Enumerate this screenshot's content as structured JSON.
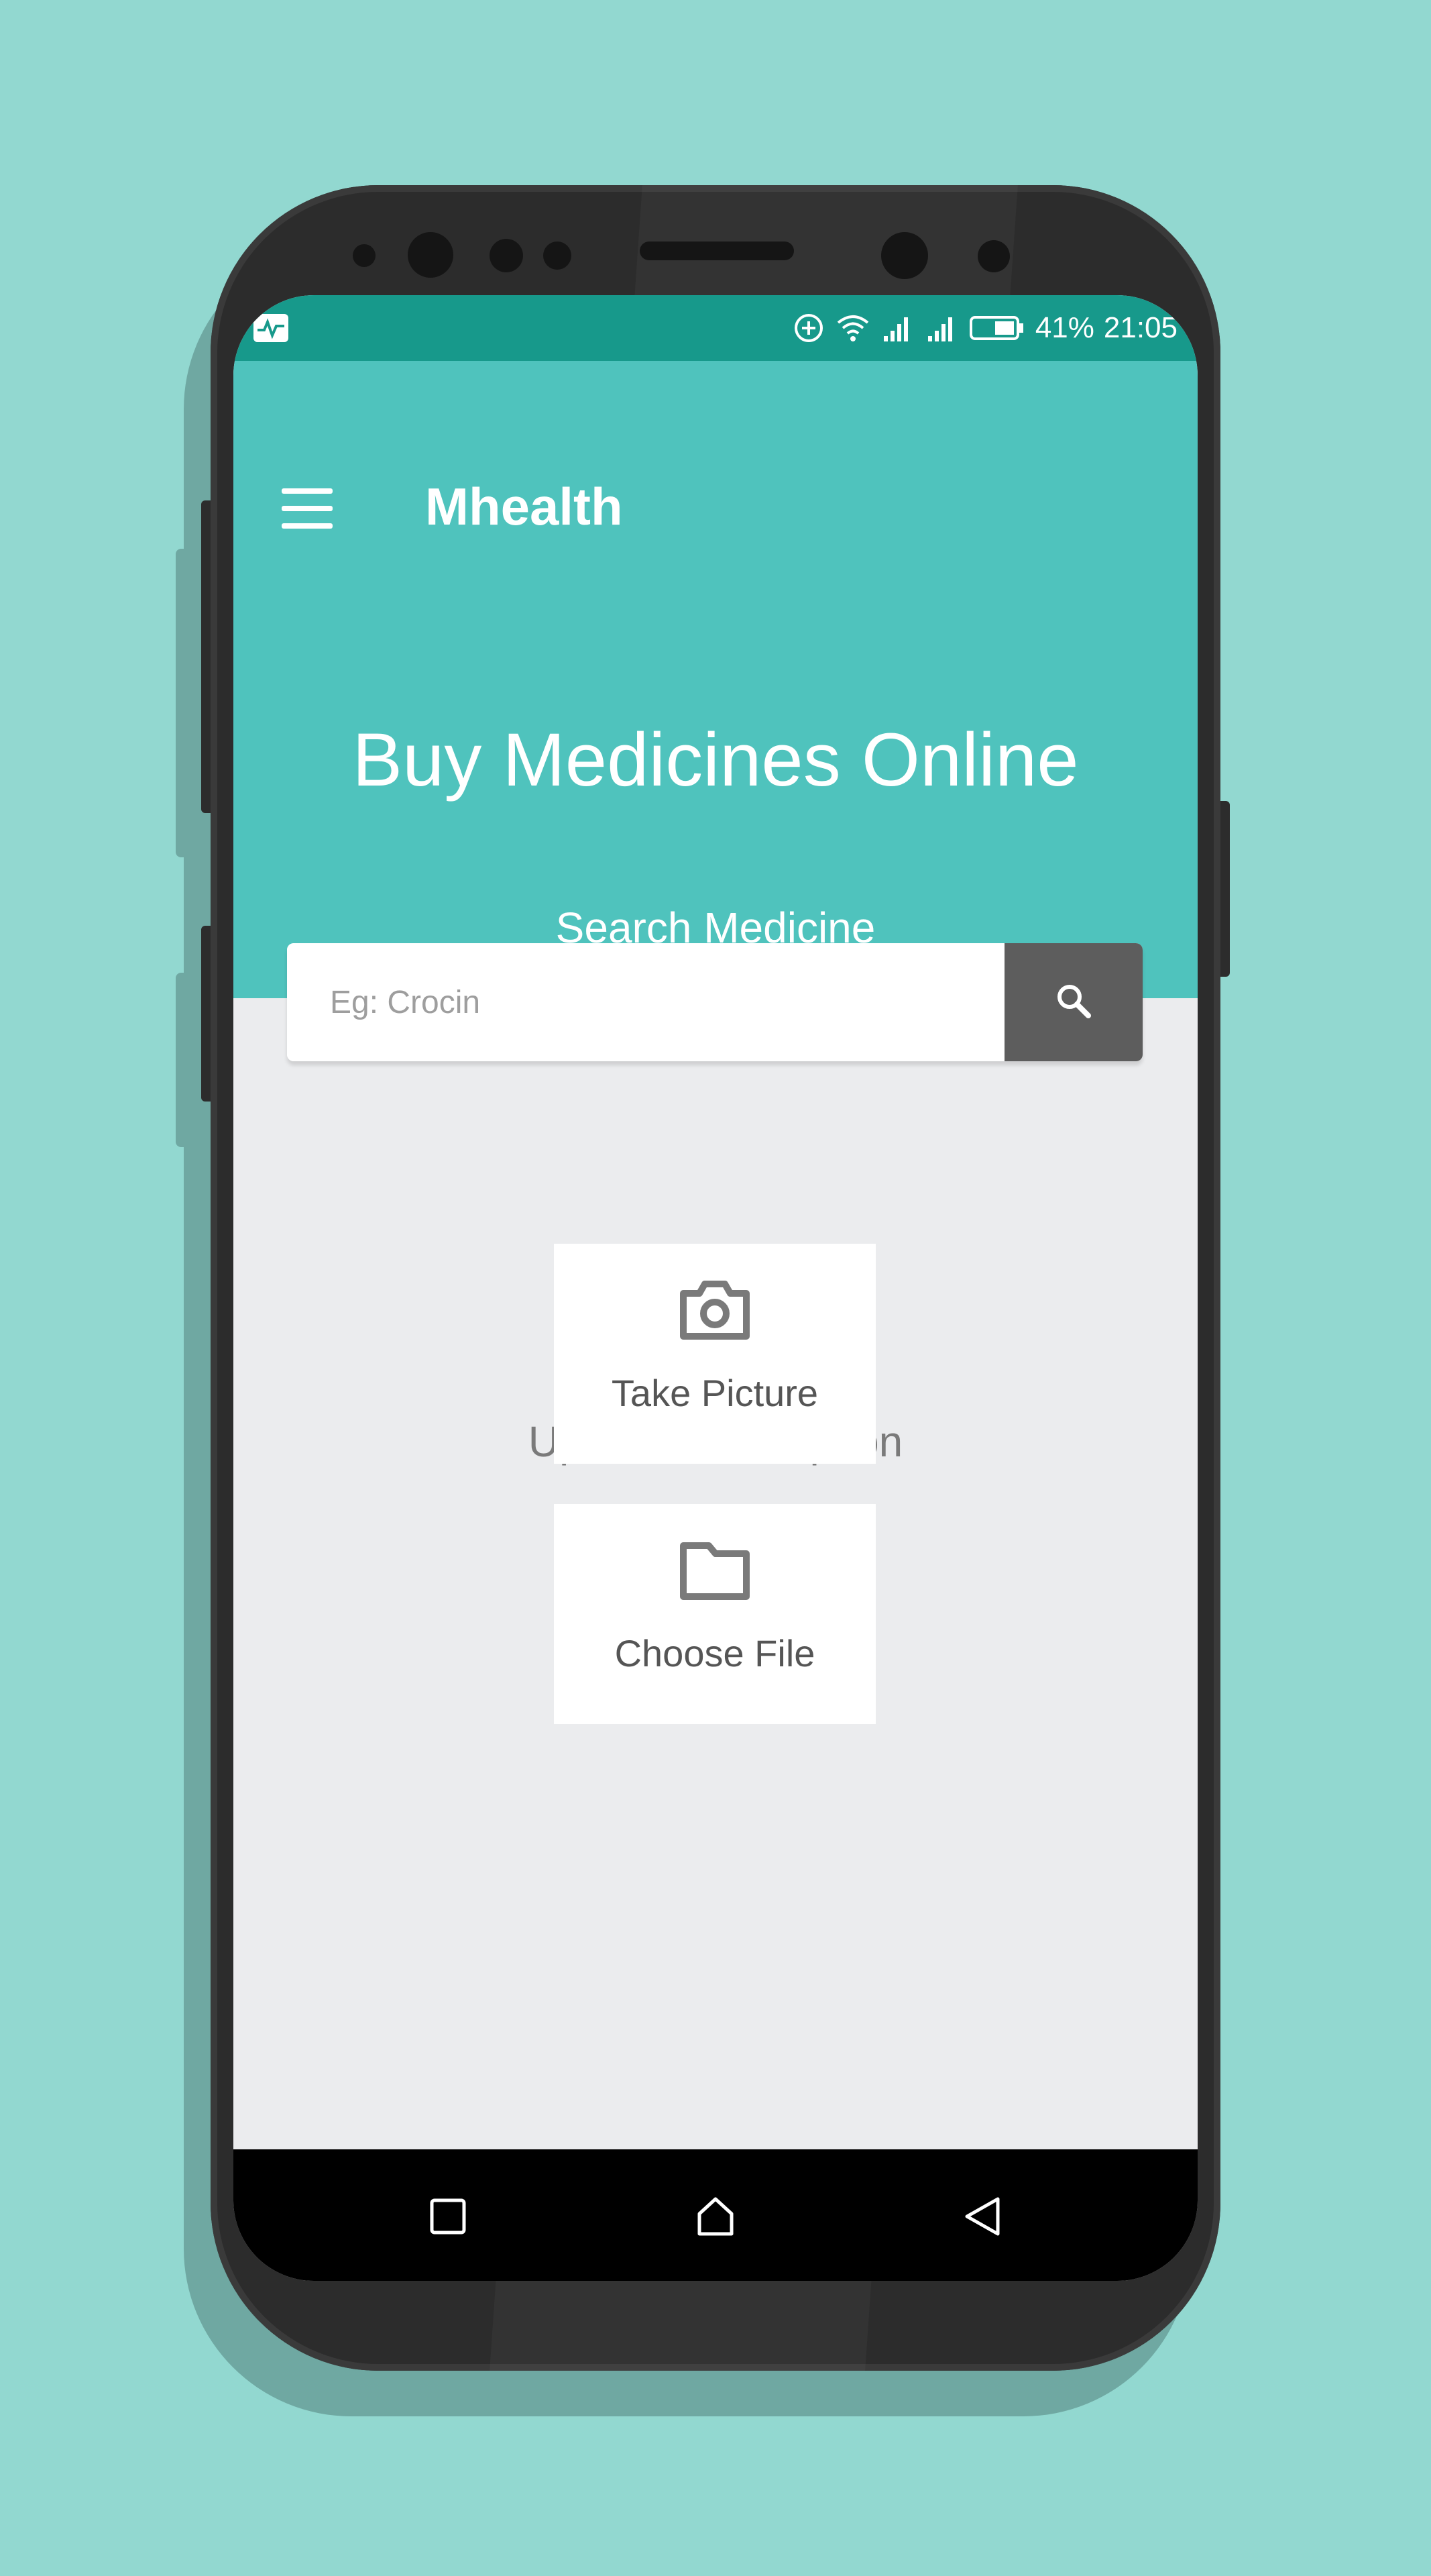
{
  "status_bar": {
    "battery": "41%",
    "time": "21:05"
  },
  "app_bar": {
    "title": "Mhealth"
  },
  "hero": {
    "headline": "Buy Medicines Online",
    "search_label": "Search Medicine"
  },
  "search": {
    "placeholder": "Eg: Crocin",
    "value": ""
  },
  "upload": {
    "label": "Upload Prescription",
    "take_picture": "Take Picture",
    "choose_file": "Choose File"
  },
  "icons": {
    "menu": "hamburger-icon",
    "search": "search-icon",
    "camera": "camera-icon",
    "folder": "folder-icon",
    "nav_recents": "square-icon",
    "nav_home": "home-icon",
    "nav_back": "back-triangle-icon"
  },
  "colors": {
    "background": "#92d8d0",
    "status_bar": "#17998b",
    "header": "#4fc3bd",
    "search_button": "#5d5d5d",
    "content_bg": "#ebecee"
  }
}
